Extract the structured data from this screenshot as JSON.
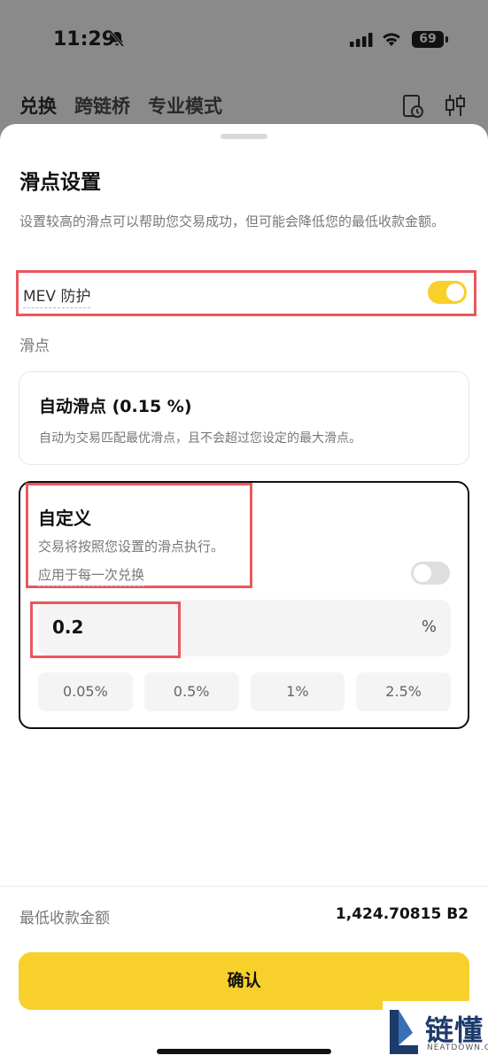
{
  "status_bar": {
    "time": "11:29",
    "battery": "69"
  },
  "top_nav": {
    "tabs": [
      "兑换",
      "跨链桥",
      "专业模式"
    ]
  },
  "sheet": {
    "title": "滑点设置",
    "description": "设置较高的滑点可以帮助您交易成功，但可能会降低您的最低收款金额。",
    "mev": {
      "label": "MEV 防护",
      "enabled": true
    },
    "slippage_label": "滑点",
    "auto": {
      "title": "自动滑点 (0.15 %)",
      "description": "自动为交易匹配最优滑点，且不会超过您设定的最大滑点。"
    },
    "custom": {
      "title": "自定义",
      "description": "交易将按照您设置的滑点执行。",
      "apply_label": "应用于每一次兑换",
      "apply_enabled": false,
      "value": "0.2",
      "unit": "%",
      "presets": [
        "0.05%",
        "0.5%",
        "1%",
        "2.5%"
      ]
    },
    "min_receive": {
      "label": "最低收款金额",
      "value": "1,424.70815 B2"
    },
    "confirm_label": "确认"
  },
  "watermark": {
    "text": "链懂",
    "sub": "NEATDOWN.COM"
  },
  "colors": {
    "accent": "#f7d02b",
    "highlight": "#e8585e"
  }
}
